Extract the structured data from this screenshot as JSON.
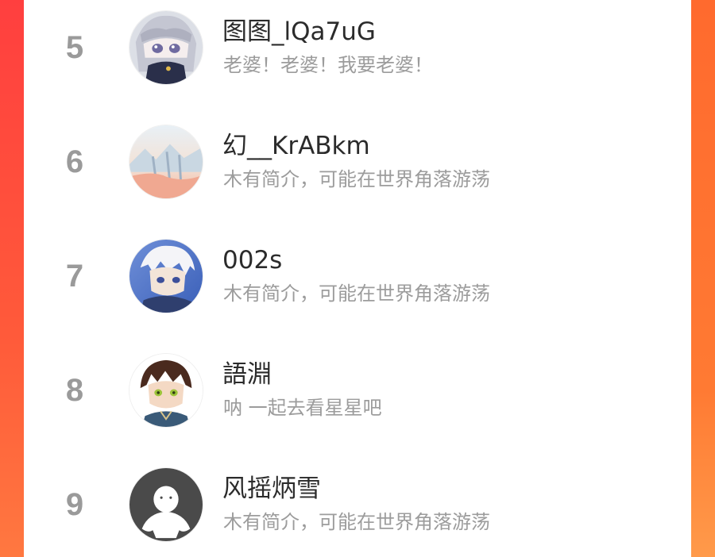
{
  "colors": {
    "rank": "#9a9a9a",
    "name": "#2b2b2b",
    "bio": "#9c9c9c",
    "edge_left": "#ff4a3c",
    "edge_right": "#ff7a33",
    "panel": "#ffffff"
  },
  "leaderboard": {
    "rows": [
      {
        "rank": "5",
        "name": "图图_lQa7uG",
        "bio": "老婆！老婆！我要老婆！",
        "avatar": "anime-girl-avatar"
      },
      {
        "rank": "6",
        "name": "幻__KrABkm",
        "bio": "木有简介，可能在世界角落游荡",
        "avatar": "landscape-avatar"
      },
      {
        "rank": "7",
        "name": "002s",
        "bio": "木有简介，可能在世界角落游荡",
        "avatar": "white-hair-boy-avatar"
      },
      {
        "rank": "8",
        "name": "語淵",
        "bio": "呐 一起去看星星吧",
        "avatar": "brown-hair-boy-avatar"
      },
      {
        "rank": "9",
        "name": "风摇炳雪",
        "bio": "木有简介，可能在世界角落游荡",
        "avatar": "default-user-avatar"
      }
    ]
  }
}
